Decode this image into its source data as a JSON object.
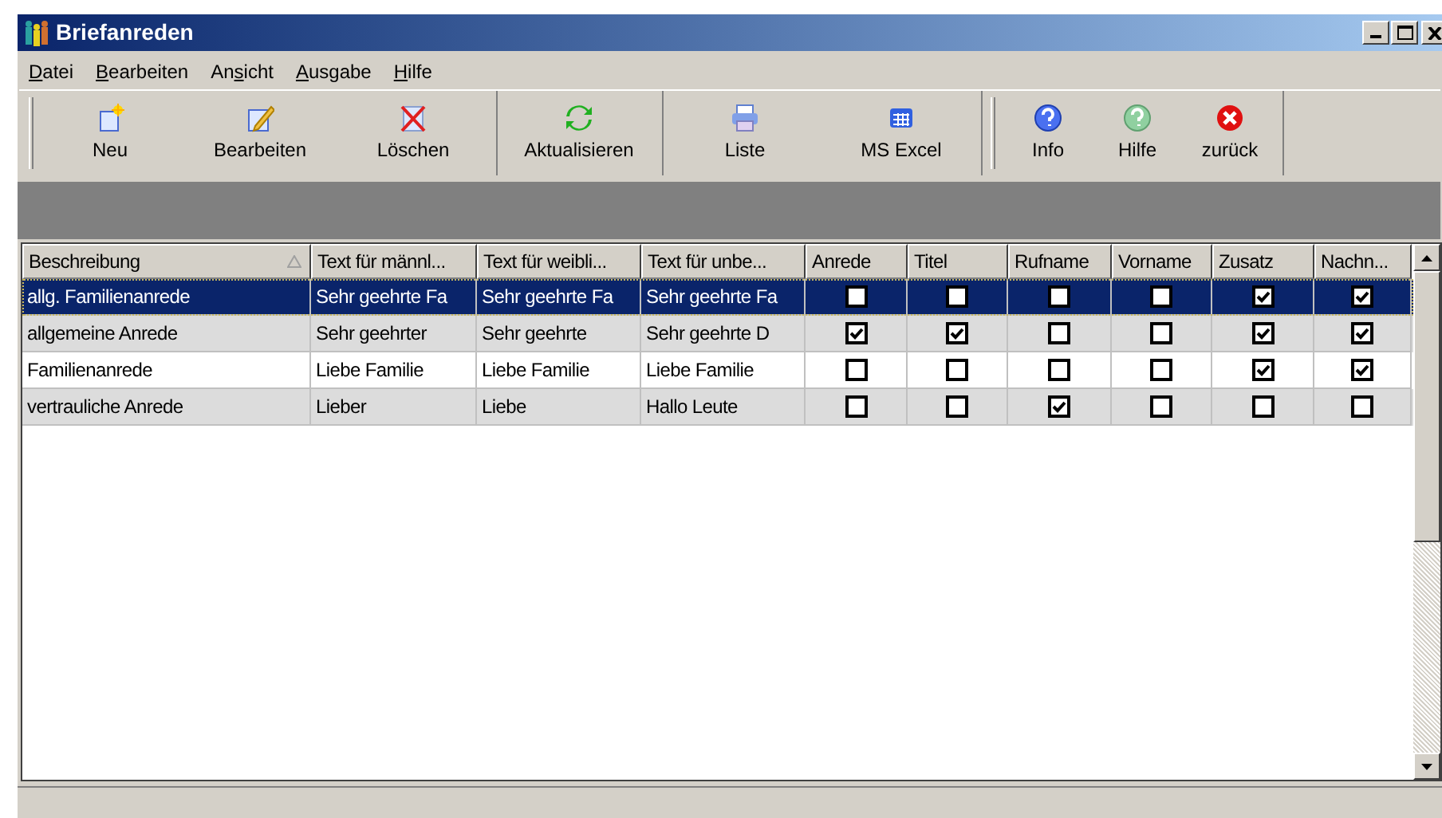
{
  "window": {
    "title": "Briefanreden"
  },
  "menu": [
    {
      "key": "D",
      "post": "atei"
    },
    {
      "key": "B",
      "post": "earbeiten"
    },
    {
      "pre": "An",
      "key": "s",
      "post": "icht"
    },
    {
      "key": "A",
      "post": "usgabe"
    },
    {
      "key": "H",
      "post": "ilfe"
    }
  ],
  "toolbar": [
    [
      {
        "label": "Neu"
      },
      {
        "label": "Bearbeiten"
      },
      {
        "label": "Löschen"
      }
    ],
    [
      {
        "label": "Aktualisieren"
      }
    ],
    [
      {
        "label": "Liste"
      },
      {
        "label": "MS Excel"
      }
    ],
    [
      {
        "label": "Info"
      },
      {
        "label": "Hilfe"
      },
      {
        "label": "zurück"
      }
    ]
  ],
  "table": {
    "columns": [
      {
        "label": "Beschreibung",
        "sorted": true
      },
      {
        "label": "Text für männl..."
      },
      {
        "label": "Text für weibli..."
      },
      {
        "label": "Text für unbe..."
      },
      {
        "label": "Anrede"
      },
      {
        "label": "Titel"
      },
      {
        "label": "Rufname"
      },
      {
        "label": "Vorname"
      },
      {
        "label": "Zusatz"
      },
      {
        "label": "Nachn..."
      }
    ],
    "rows": [
      {
        "selected": true,
        "texts": [
          "allg. Familienanrede",
          "Sehr geehrte Fa",
          "Sehr geehrte Fa",
          "Sehr geehrte Fa"
        ],
        "checks": [
          false,
          false,
          false,
          false,
          true,
          true
        ]
      },
      {
        "selected": false,
        "texts": [
          "allgemeine Anrede",
          "Sehr geehrter",
          "Sehr geehrte",
          "Sehr geehrte D"
        ],
        "checks": [
          true,
          true,
          false,
          false,
          true,
          true
        ]
      },
      {
        "selected": false,
        "texts": [
          "Familienanrede",
          "Liebe Familie",
          "Liebe Familie",
          "Liebe Familie"
        ],
        "checks": [
          false,
          false,
          false,
          false,
          true,
          true
        ]
      },
      {
        "selected": false,
        "texts": [
          "vertrauliche Anrede",
          "Lieber",
          "Liebe",
          "Hallo Leute"
        ],
        "checks": [
          false,
          false,
          true,
          false,
          false,
          false
        ]
      }
    ]
  }
}
